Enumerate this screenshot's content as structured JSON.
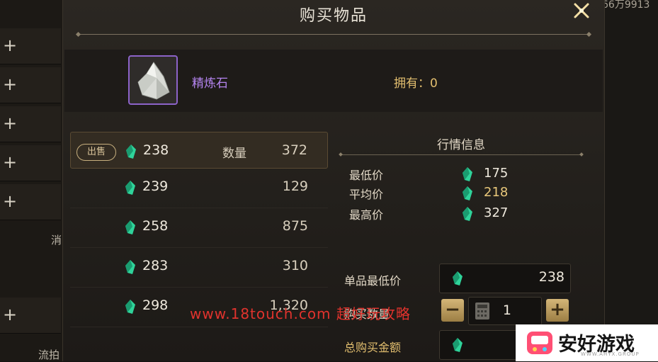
{
  "background": {
    "top_right_text": "66万9913",
    "side_text_1": "消",
    "side_text_2": "流拍"
  },
  "dialog": {
    "title": "购买物品",
    "close_icon": "close-x-icon"
  },
  "item": {
    "name": "精炼石",
    "owned_label": "拥有：0"
  },
  "listings": {
    "sell_badge": "出售",
    "qty_label": "数量",
    "rows": [
      {
        "price": "238",
        "qty": "372"
      },
      {
        "price": "239",
        "qty": "129"
      },
      {
        "price": "258",
        "qty": "875"
      },
      {
        "price": "283",
        "qty": "310"
      },
      {
        "price": "298",
        "qty": "1,320"
      }
    ]
  },
  "market": {
    "title": "行情信息",
    "min_label": "最低价",
    "min_value": "175",
    "avg_label": "平均价",
    "avg_value": "218",
    "max_label": "最高价",
    "max_value": "327"
  },
  "purchase": {
    "unit_min_label": "单品最低价",
    "unit_min_value": "238",
    "qty_label": "购买数量",
    "qty_value": "1",
    "minus": "−",
    "plus": "+",
    "total_label": "总购买金额"
  },
  "overlay": {
    "watermark": "www.18touch.com 超好玩攻略",
    "logo_text": "安好游戏",
    "logo_sub": "WWW.AHYX.GROUP"
  },
  "colors": {
    "accent_gold": "#e3bf6f",
    "item_purple": "#b585f0",
    "gem_green": "#2fd39a"
  }
}
